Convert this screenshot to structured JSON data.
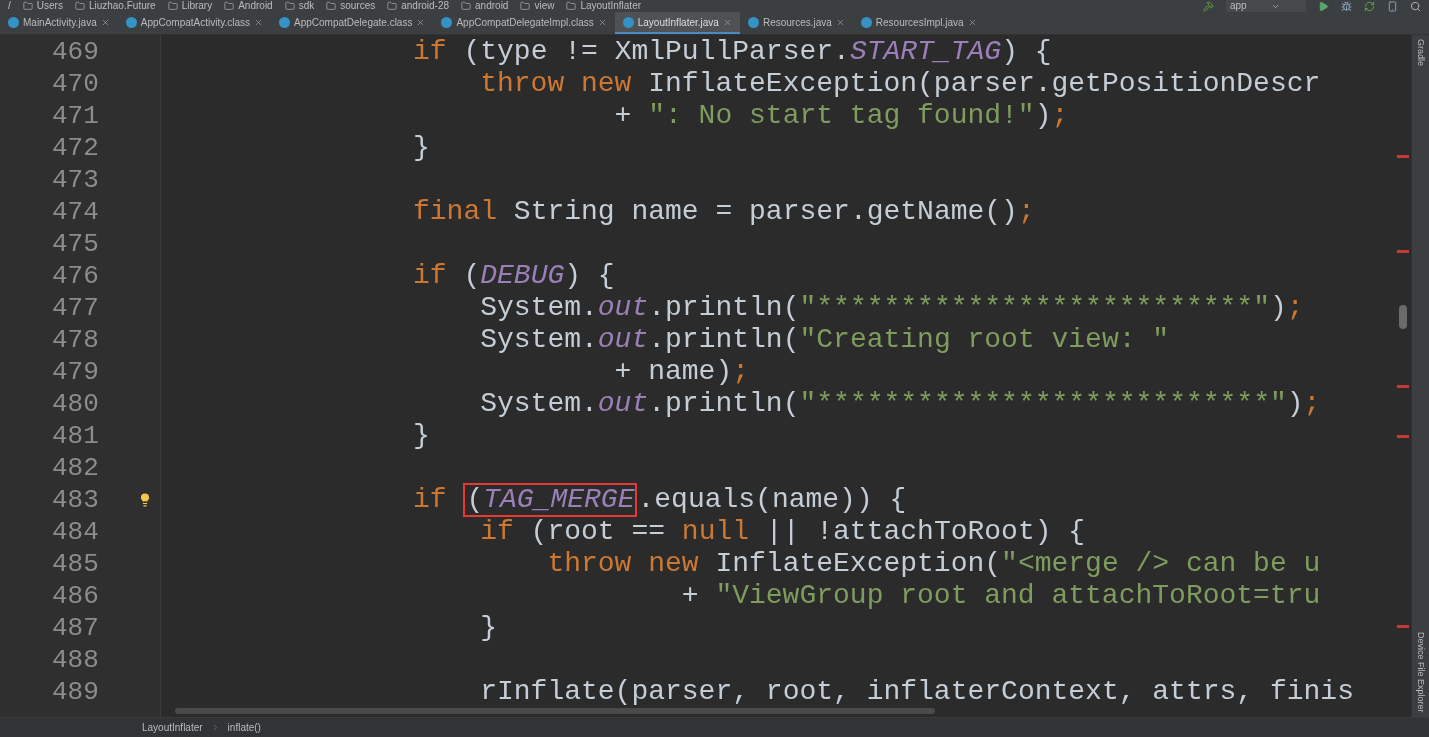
{
  "path_bar": [
    "/",
    "Users",
    "Liuzhao.Future",
    "Library",
    "Android",
    "sdk",
    "sources",
    "android-28",
    "android",
    "view",
    "LayoutInflater"
  ],
  "run_config": "app",
  "tabs": [
    {
      "label": "MainActivity.java",
      "selected": false
    },
    {
      "label": "AppCompatActivity.class",
      "selected": false
    },
    {
      "label": "AppCompatDelegate.class",
      "selected": false
    },
    {
      "label": "AppCompatDelegateImpl.class",
      "selected": false
    },
    {
      "label": "LayoutInflater.java",
      "selected": true
    },
    {
      "label": "Resources.java",
      "selected": false
    },
    {
      "label": "ResourcesImpl.java",
      "selected": false
    }
  ],
  "code_lines": [
    {
      "number": "469",
      "tokens": [
        {
          "kind": "kw",
          "text": "if "
        },
        {
          "kind": "plain",
          "text": "(type != XmlPullParser."
        },
        {
          "kind": "field",
          "text": "START_TAG"
        },
        {
          "kind": "plain",
          "text": ") {"
        }
      ],
      "children": [
        {
          "number": "470",
          "tokens": [
            {
              "kind": "kw",
              "text": "throw new "
            },
            {
              "kind": "plain",
              "text": "InflateException(parser.getPositionDescr"
            }
          ]
        },
        {
          "number": "471",
          "kind": "continuation",
          "tokens": [
            {
              "kind": "plain",
              "text": "+ "
            },
            {
              "kind": "str",
              "text": "\": No start tag found!\""
            },
            {
              "kind": "plain",
              "text": ")"
            },
            {
              "kind": "kw",
              "text": ";"
            }
          ]
        }
      ]
    },
    {
      "number": "472",
      "tokens": [
        {
          "kind": "plain",
          "text": "}"
        }
      ]
    },
    {
      "number": "473"
    },
    {
      "number": "474",
      "tokens": [
        {
          "kind": "kw",
          "text": "final "
        },
        {
          "kind": "plain",
          "text": "String name = parser.getName()"
        },
        {
          "kind": "kw",
          "text": ";"
        }
      ]
    },
    {
      "number": "475"
    },
    {
      "number": "476",
      "tokens": [
        {
          "kind": "kw",
          "text": "if "
        },
        {
          "kind": "plain",
          "text": "("
        },
        {
          "kind": "field",
          "text": "DEBUG"
        },
        {
          "kind": "plain",
          "text": ") {"
        }
      ],
      "children": [
        {
          "number": "477",
          "tokens": [
            {
              "kind": "plain",
              "text": "System."
            },
            {
              "kind": "field",
              "text": "out"
            },
            {
              "kind": "plain",
              "text": ".println("
            },
            {
              "kind": "str",
              "text": "\"**************************\""
            },
            {
              "kind": "plain",
              "text": ")"
            },
            {
              "kind": "kw",
              "text": ";"
            }
          ]
        },
        {
          "number": "478",
          "tokens": [
            {
              "kind": "plain",
              "text": "System."
            },
            {
              "kind": "field",
              "text": "out"
            },
            {
              "kind": "plain",
              "text": ".println("
            },
            {
              "kind": "str",
              "text": "\"Creating root view: \""
            }
          ]
        },
        {
          "number": "479",
          "kind": "continuation",
          "tokens": [
            {
              "kind": "plain",
              "text": "+ name)"
            },
            {
              "kind": "kw",
              "text": ";"
            }
          ]
        },
        {
          "number": "480",
          "tokens": [
            {
              "kind": "plain",
              "text": "System."
            },
            {
              "kind": "field",
              "text": "out"
            },
            {
              "kind": "plain",
              "text": ".println("
            },
            {
              "kind": "str",
              "text": "\"***************************\""
            },
            {
              "kind": "plain",
              "text": ")"
            },
            {
              "kind": "kw",
              "text": ";"
            }
          ]
        }
      ]
    },
    {
      "number": "481",
      "tokens": [
        {
          "kind": "plain",
          "text": "}"
        }
      ]
    },
    {
      "number": "482"
    },
    {
      "number": "483",
      "bulb": true,
      "tokens": [
        {
          "kind": "kw",
          "text": "if "
        },
        {
          "kind": "box",
          "tokens": [
            {
              "kind": "plain",
              "text": "("
            },
            {
              "kind": "field",
              "text": "TAG_MERGE"
            }
          ]
        },
        {
          "kind": "plain",
          "text": ".equals(name)) {"
        }
      ],
      "children": [
        {
          "number": "484",
          "tokens": [
            {
              "kind": "kw",
              "text": "if "
            },
            {
              "kind": "plain",
              "text": "(root == "
            },
            {
              "kind": "kw",
              "text": "null "
            },
            {
              "kind": "plain",
              "text": "|| !attachToRoot) {"
            }
          ],
          "children": [
            {
              "number": "485",
              "tokens": [
                {
                  "kind": "kw",
                  "text": "throw new "
                },
                {
                  "kind": "plain",
                  "text": "InflateException("
                },
                {
                  "kind": "str",
                  "text": "\"<merge /> can be u"
                }
              ]
            },
            {
              "number": "486",
              "kind": "continuation",
              "tokens": [
                {
                  "kind": "plain",
                  "text": "+ "
                },
                {
                  "kind": "str",
                  "text": "\"ViewGroup root and attachToRoot=tru"
                }
              ]
            }
          ]
        },
        {
          "number": "487",
          "tokens": [
            {
              "kind": "plain",
              "text": "}"
            }
          ]
        },
        {
          "number": "488"
        },
        {
          "number": "489",
          "tokens": [
            {
              "kind": "plain",
              "text": "rInflate(parser, root, inflaterContext, attrs, finis"
            }
          ]
        }
      ]
    }
  ],
  "breadcrumb": [
    "LayoutInflater",
    "inflate()"
  ],
  "tool_windows": [
    {
      "label": "Gradle"
    },
    {
      "label": "Device File Explorer"
    }
  ]
}
